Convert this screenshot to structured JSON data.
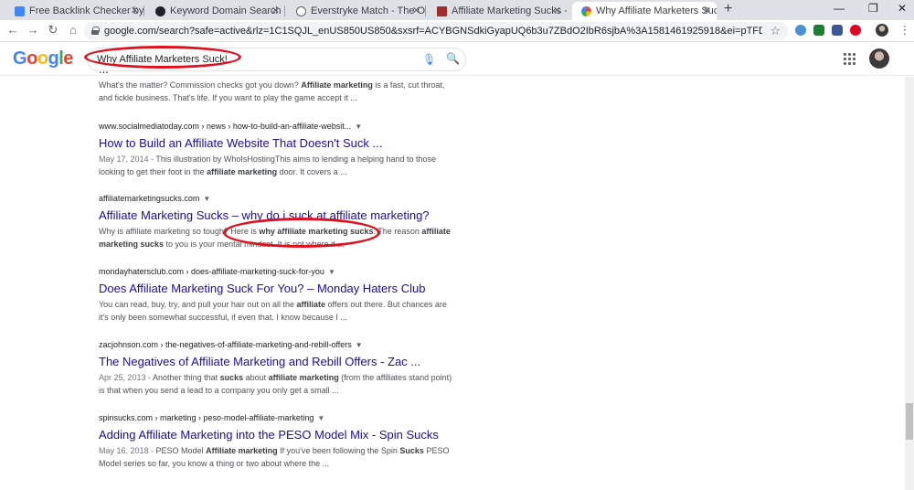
{
  "tabs": [
    {
      "title": "Free Backlink Checker by Ahrefs",
      "icon": "hand-icon",
      "color": "#4285f4"
    },
    {
      "title": "Keyword Domain Search » Expired",
      "icon": "dark-circle-icon",
      "color": "#202124"
    },
    {
      "title": "Everstryke Match - The Official Po",
      "icon": "globe-icon",
      "color": "#5f6368"
    },
    {
      "title": "Affiliate Marketing Sucks - Why D",
      "icon": "page-icon",
      "color": "#a52a2a"
    },
    {
      "title": "Why Affiliate Marketers Suck! - G",
      "icon": "google-icon",
      "color": "#4285f4"
    }
  ],
  "browser": {
    "url": "google.com/search?safe=active&rlz=1C1SQJL_enUS850US850&sxsrf=ACYBGNSdkiGyapUQ6b3u7ZBdO2IbR6sjbA%3A1581461925918&ei=pTFDXvjYN868tQXR8p6oBA&q=Why+..."
  },
  "search": {
    "logo": "Google",
    "query": "Why Affiliate Marketers Suck!"
  },
  "results": [
    {
      "title": "...",
      "snippet_html": "What's the matter? Commission checks got you down? <b>Affiliate marketing</b> is a fast, cut throat, and fickle business. That's life. If you want to play the game accept it ..."
    },
    {
      "cite": "www.socialmediatoday.com › news › how-to-build-an-affiliate-websit...",
      "title": "How to Build an Affiliate Website That Doesn't Suck ...",
      "snippet_html": "<span class='date'>May 17, 2014 - </span>This illustration by WhoIsHostingThis aims to lending a helping hand to those looking to get their foot in the <b>affiliate marketing</b> door. It covers a ..."
    },
    {
      "cite": "affiliatemarketingsucks.com",
      "title": "Affiliate Marketing Sucks – why do i suck at affiliate marketing?",
      "snippet_html": "Why is affiliate marketing so tough? Here is <b>why affiliate marketing sucks</b>. The reason <b>affiliate marketing sucks</b> to you is your mental mindset. It is not where it ..."
    },
    {
      "cite": "mondayhatersclub.com › does-affiliate-marketing-suck-for-you",
      "title": "Does Affiliate Marketing Suck For You? – Monday Haters Club",
      "snippet_html": "You can read, buy, try, and pull your hair out on all the <b>affiliate</b> offers out there. But chances are it's only been somewhat successful, if even that. I know because I ..."
    },
    {
      "cite": "zacjohnson.com › the-negatives-of-affiliate-marketing-and-rebill-offers",
      "title": "The Negatives of Affiliate Marketing and Rebill Offers - Zac ...",
      "snippet_html": "<span class='date'>Apr 25, 2013 - </span>Another thing that <b>sucks</b> about <b>affiliate marketing</b> (from the affiliates stand point) is that when you send a lead to a company you only get a small ..."
    },
    {
      "cite": "spinsucks.com › marketing › peso-model-affiliate-marketing",
      "title": "Adding Affiliate Marketing into the PESO Model Mix - Spin Sucks",
      "snippet_html": "<span class='date'>May 16, 2018 - </span>PESO Model <b>Affiliate marketing</b> If you've been following the Spin <b>Sucks</b> PESO Model series so far, you know a thing or two about where the ..."
    }
  ],
  "colors": {
    "link": "#1a0dab",
    "annotation": "#e0101c"
  }
}
